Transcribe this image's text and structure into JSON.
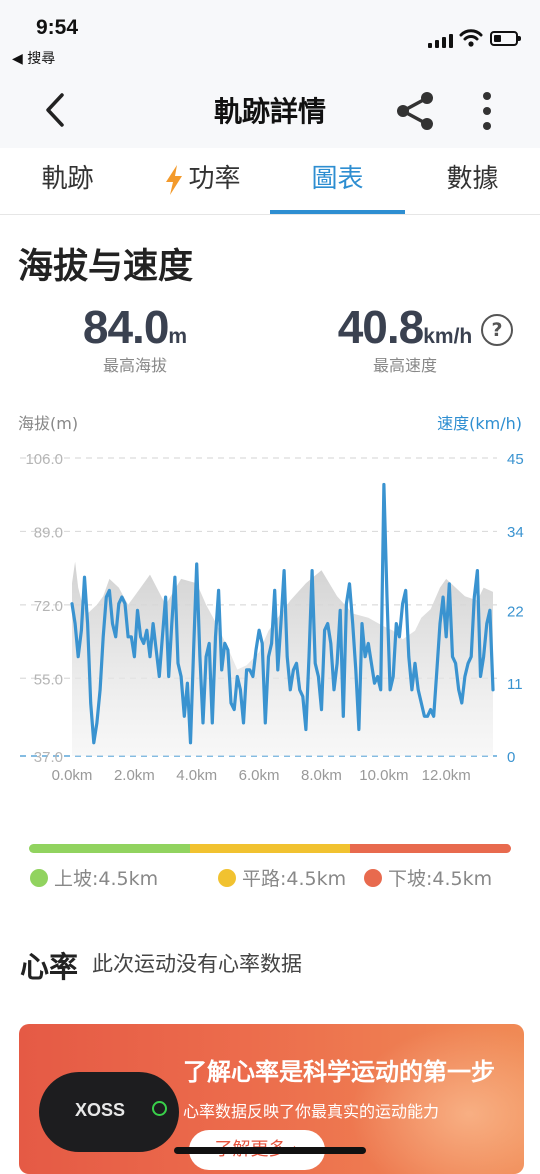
{
  "status_bar": {
    "time": "9:54",
    "back_app": "◀ 搜尋"
  },
  "nav": {
    "title": "軌跡詳情",
    "back_icon": "chevron-left-icon",
    "share_icon": "share-icon",
    "more_icon": "more-vertical-icon"
  },
  "tabs": [
    {
      "label": "軌跡"
    },
    {
      "label": "功率",
      "icon": "lightning-icon"
    },
    {
      "label": "圖表",
      "active": true
    },
    {
      "label": "數據"
    }
  ],
  "section": {
    "title": "海拔与速度",
    "max_altitude": {
      "value": "84.0",
      "unit": "m",
      "label": "最高海拔"
    },
    "max_speed": {
      "value": "40.8",
      "unit": "km/h",
      "label": "最高速度"
    }
  },
  "chart_data": {
    "type": "line",
    "left_axis_title": "海拔(m)",
    "right_axis_title": "速度(km/h)",
    "left_ticks": [
      "106.0",
      "89.0",
      "72.0",
      "55.0",
      "37.0"
    ],
    "right_ticks": [
      "45",
      "34",
      "22",
      "11",
      "0"
    ],
    "x_ticks": [
      "0.0km",
      "2.0km",
      "4.0km",
      "6.0km",
      "8.0km",
      "10.0km",
      "12.0km"
    ],
    "xlim": [
      0,
      13.5
    ],
    "ylim_left": [
      37,
      106
    ],
    "ylim_right": [
      0,
      45
    ],
    "grid": true,
    "series": [
      {
        "axis": "left",
        "color": "#d8d8d8",
        "x": [
          0.0,
          0.1,
          0.2,
          0.3,
          0.5,
          0.8,
          1.0,
          1.2,
          1.5,
          1.8,
          2.0,
          2.5,
          3.0,
          3.5,
          4.0,
          4.3,
          4.6,
          5.0,
          5.3,
          5.6,
          6.0,
          6.3,
          6.6,
          7.0,
          7.5,
          8.0,
          8.5,
          9.0,
          9.5,
          10.0,
          10.3,
          10.6,
          11.0,
          11.2,
          11.5,
          11.8,
          12.0,
          12.3,
          12.6,
          13.0,
          13.2,
          13.5
        ],
        "values": [
          77,
          82,
          76,
          73,
          70,
          72,
          74,
          78,
          76,
          72,
          74,
          79,
          72,
          78,
          77,
          72,
          68,
          62,
          57,
          58,
          61,
          66,
          69,
          73,
          77,
          80,
          74,
          70,
          69,
          67,
          66,
          64,
          66,
          69,
          71,
          76,
          78,
          76,
          74,
          73,
          76,
          75
        ]
      },
      {
        "axis": "right",
        "color": "#3a93d0",
        "x": [
          0.0,
          0.1,
          0.2,
          0.3,
          0.4,
          0.5,
          0.6,
          0.7,
          0.8,
          0.9,
          1.0,
          1.1,
          1.2,
          1.3,
          1.4,
          1.5,
          1.6,
          1.7,
          1.8,
          1.9,
          2.0,
          2.1,
          2.2,
          2.3,
          2.4,
          2.5,
          2.6,
          2.7,
          2.8,
          2.9,
          3.0,
          3.1,
          3.2,
          3.3,
          3.4,
          3.5,
          3.6,
          3.7,
          3.8,
          3.9,
          4.0,
          4.1,
          4.2,
          4.3,
          4.4,
          4.5,
          4.6,
          4.7,
          4.8,
          4.9,
          5.0,
          5.1,
          5.2,
          5.3,
          5.4,
          5.5,
          5.6,
          5.7,
          5.8,
          5.9,
          6.0,
          6.1,
          6.2,
          6.3,
          6.4,
          6.5,
          6.6,
          6.7,
          6.8,
          6.9,
          7.0,
          7.1,
          7.2,
          7.3,
          7.4,
          7.5,
          7.6,
          7.7,
          7.8,
          7.9,
          8.0,
          8.1,
          8.2,
          8.3,
          8.4,
          8.5,
          8.6,
          8.7,
          8.8,
          8.9,
          9.0,
          9.1,
          9.2,
          9.3,
          9.4,
          9.5,
          9.6,
          9.7,
          9.8,
          9.9,
          10.0,
          10.1,
          10.2,
          10.3,
          10.4,
          10.5,
          10.6,
          10.7,
          10.8,
          10.9,
          11.0,
          11.1,
          11.2,
          11.3,
          11.4,
          11.5,
          11.6,
          11.7,
          11.8,
          11.9,
          12.0,
          12.1,
          12.2,
          12.3,
          12.4,
          12.5,
          12.6,
          12.7,
          12.8,
          12.9,
          13.0,
          13.1,
          13.2,
          13.3,
          13.4,
          13.5
        ],
        "values": [
          23,
          20,
          15,
          19,
          27,
          20,
          8,
          2,
          5,
          10,
          18,
          24,
          25,
          20,
          18,
          23,
          24,
          23,
          18,
          18,
          15,
          22,
          18,
          17,
          19,
          15,
          20,
          16,
          12,
          18,
          24,
          12,
          20,
          27,
          14,
          12,
          6,
          11,
          2,
          16,
          29,
          15,
          5,
          15,
          17,
          5,
          18,
          25,
          13,
          17,
          16,
          8,
          7,
          12,
          10,
          5,
          13,
          13,
          12,
          16,
          19,
          17,
          5,
          15,
          17,
          25,
          13,
          20,
          28,
          15,
          10,
          13,
          14,
          10,
          9,
          4,
          15,
          28,
          14,
          12,
          7,
          19,
          20,
          17,
          10,
          14,
          22,
          6,
          23,
          26,
          20,
          13,
          4,
          20,
          15,
          17,
          14,
          11,
          12,
          10,
          41,
          24,
          10,
          12,
          20,
          18,
          23,
          25,
          15,
          10,
          14,
          10,
          8,
          6,
          6,
          7,
          6,
          13,
          20,
          24,
          18,
          26,
          15,
          14,
          10,
          8,
          12,
          14,
          15,
          24,
          28,
          12,
          15,
          20,
          22,
          10
        ]
      }
    ]
  },
  "terrain": {
    "colors": [
      "#91d35f",
      "#f1c230",
      "#e86a4e"
    ],
    "items": [
      {
        "label": "上坡:4.5km",
        "color": "#91d35f"
      },
      {
        "label": "平路:4.5km",
        "color": "#f1c230"
      },
      {
        "label": "下坡:4.5km",
        "color": "#e86a4e"
      }
    ]
  },
  "heart_rate": {
    "title": "心率",
    "note": "此次运动没有心率数据"
  },
  "banner": {
    "device_brand": "XOSS",
    "title": "了解心率是科学运动的第一步",
    "subtitle": "心率数据反映了你最真实的运动能力",
    "button": "了解更多 ›"
  }
}
